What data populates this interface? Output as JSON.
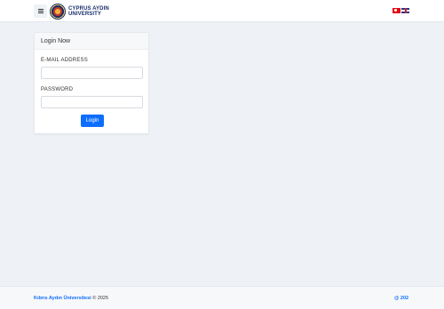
{
  "header": {
    "logo_line1": "CYPRUS AYDIN",
    "logo_line2": "UNIVERSITY",
    "languages": [
      "tr",
      "en"
    ]
  },
  "login": {
    "title": "Login Now",
    "email_label": "E-MAIL ADDRESS",
    "email_value": "",
    "password_label": "PASSWORD",
    "password_value": "",
    "button_label": "Login"
  },
  "footer": {
    "link_text": "Kıbrıs Aydın Üniversitesi",
    "copyright": "© 2025",
    "right_text": "@ 202"
  },
  "colors": {
    "accent": "#0d6efd",
    "brand": "#1a2f6b",
    "background": "#eef1f5"
  }
}
